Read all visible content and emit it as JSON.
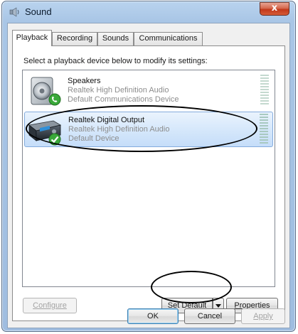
{
  "window": {
    "title": "Sound",
    "close_label": "x"
  },
  "tabs": [
    {
      "label": "Playback",
      "active": true
    },
    {
      "label": "Recording",
      "active": false
    },
    {
      "label": "Sounds",
      "active": false
    },
    {
      "label": "Communications",
      "active": false
    }
  ],
  "playback": {
    "instruction": "Select a playback device below to modify its settings:",
    "devices": [
      {
        "name": "Speakers",
        "line1": "Realtek High Definition Audio",
        "line2": "Default Communications Device",
        "icon": "speaker-icon",
        "status_icon": "phone-status-icon",
        "selected": false
      },
      {
        "name": "Realtek Digital Output",
        "line1": "Realtek High Definition Audio",
        "line2": "Default Device",
        "icon": "digital-output-icon",
        "status_icon": "default-check-icon",
        "selected": true
      }
    ],
    "buttons": {
      "configure": "Configure",
      "set_default": "Set Default",
      "properties": "Properties"
    }
  },
  "dialog_buttons": {
    "ok": "OK",
    "cancel": "Cancel",
    "apply": "Apply"
  },
  "colors": {
    "selection": "#cde3fa",
    "title_gradient": "#a9c6e6",
    "close_button": "#c1381a",
    "check_green": "#3aa93a"
  }
}
